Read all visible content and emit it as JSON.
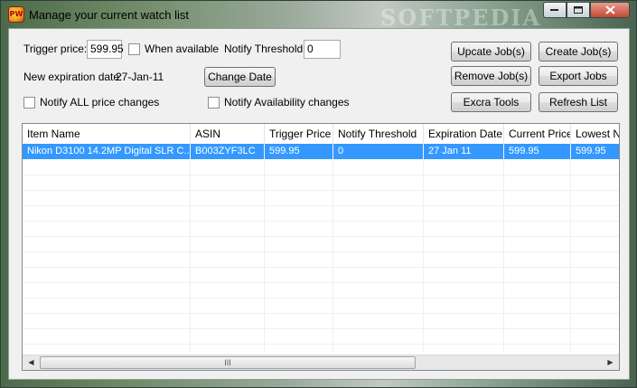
{
  "window": {
    "title": "Manage your current watch list",
    "watermark": "SOFTPEDIA"
  },
  "form": {
    "trigger_price_label": "Trigger price:",
    "trigger_price_value": "599.95",
    "when_available_label": "When available",
    "notify_threshold_label": "Notify Threshold:",
    "notify_threshold_value": "0",
    "new_expiration_label": "New expiration date:",
    "new_expiration_value": "27-Jan-11",
    "change_date_label": "Change Date",
    "notify_all_label": "Notify ALL price changes",
    "notify_avail_label": "Notify Availability changes"
  },
  "buttons": {
    "update": "Upcate Job(s)",
    "create": "Create Job(s)",
    "remove": "Remove Job(s)",
    "export": "Export Jobs",
    "extra": "Excra Tools",
    "refresh": "Refresh List"
  },
  "table": {
    "columns": [
      "Item Name",
      "ASIN",
      "Trigger Price",
      "Notify Threshold",
      "Expiration Date",
      "Current Price",
      "Lowest Ne"
    ],
    "rows": [
      [
        "Nikon D3100 14.2MP Digital SLR C...",
        "B003ZYF3LC",
        "599.95",
        "0",
        "27 Jan 11",
        "599.95",
        "599.95"
      ]
    ]
  },
  "scrollbar": {
    "thumb_grip": "III",
    "left_arrow": "◀",
    "right_arrow": "▶"
  }
}
